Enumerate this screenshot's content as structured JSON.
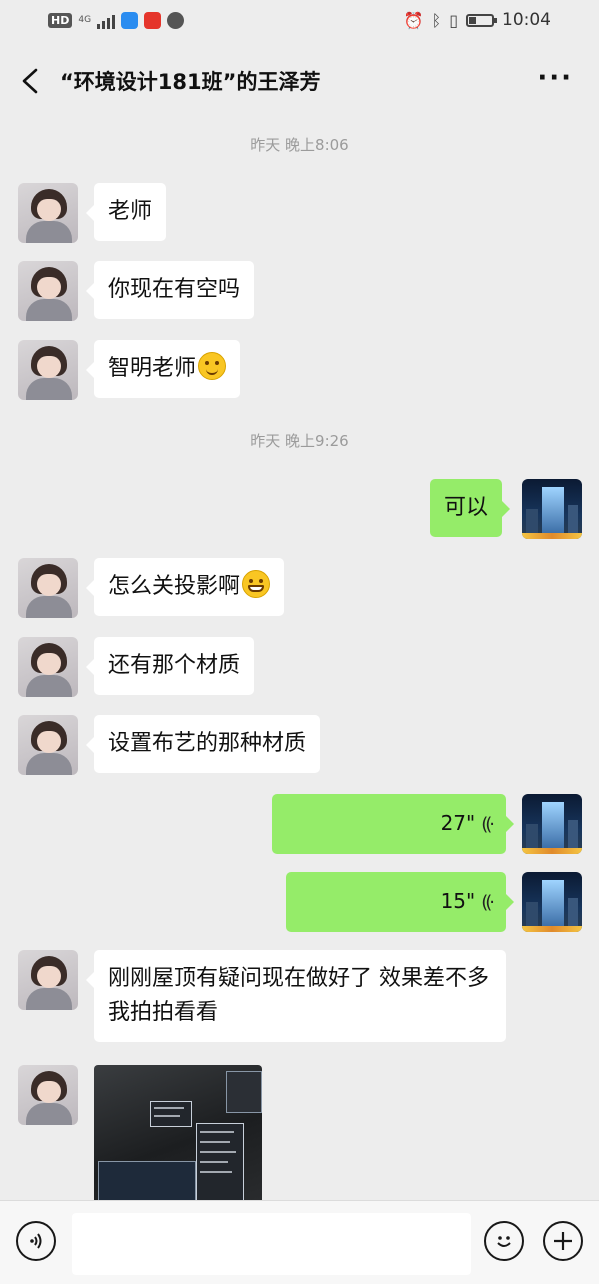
{
  "status_bar": {
    "hd": "HD",
    "network": "4G",
    "time": "10:04",
    "icons": [
      "alarm-icon",
      "bluetooth-icon",
      "vibrate-icon",
      "battery-icon"
    ],
    "battery_level": 0.3
  },
  "header": {
    "title": "“环境设计181班”的王泽芳",
    "back_icon": "chevron-left-icon",
    "more_icon": "more-dots-icon"
  },
  "messages": {
    "ts1": "昨天 晚上8:06",
    "m1": "老师",
    "m2": "你现在有空吗",
    "m3": "智明老师",
    "ts2": "昨天 晚上9:26",
    "m4": "可以",
    "m5": "怎么关投影啊",
    "m6": "还有那个材质",
    "m7": "设置布艺的那种材质",
    "v1": "27\"",
    "v2": "15\"",
    "m8": "刚刚屋顶有疑问现在做好了 效果差不多我拍拍看看"
  },
  "bottom_bar": {
    "voice_icon": "voice-icon",
    "emoji_icon": "emoji-icon",
    "plus_icon": "plus-icon",
    "input_value": ""
  },
  "colors": {
    "background": "#ededed",
    "outgoing_bubble": "#95ec69",
    "incoming_bubble": "#ffffff",
    "timestamp": "#9b9b9b"
  }
}
